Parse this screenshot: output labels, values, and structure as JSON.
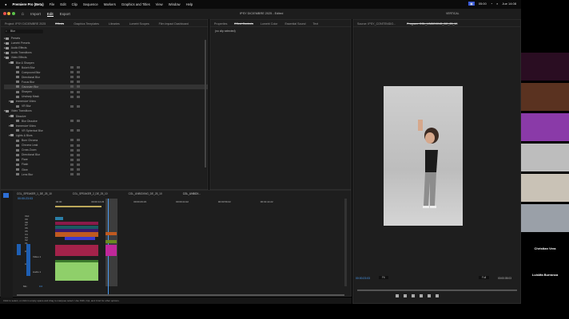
{
  "menubar": {
    "app": "Premiere Pro (Beta)",
    "items": [
      "File",
      "Edit",
      "Clip",
      "Sequence",
      "Markers",
      "Graphics and Titles",
      "View",
      "Window",
      "Help"
    ],
    "clock": "Jue 14:08",
    "battery": "05:00"
  },
  "appbar": {
    "tabs": [
      "Import",
      "Edit",
      "Export"
    ],
    "active": "Edit",
    "doc_title": "IPSY DICIEMBRE 2025 - Edited",
    "workspace": "VERTICAL"
  },
  "effects_panel": {
    "project_tab": "Project: IPSY DICIEMBRE 2025",
    "tabs": [
      "Effects",
      "Graphics Templates",
      "Libraries",
      "Lumetri Scopes",
      "Film Impact Dashboard"
    ],
    "search_value": "Blur",
    "items": [
      {
        "label": "Presets",
        "level": 0
      },
      {
        "label": "Lumetri Presets",
        "level": 0
      },
      {
        "label": "Audio Effects",
        "level": 0
      },
      {
        "label": "Audio Transitions",
        "level": 0
      },
      {
        "label": "Video Effects",
        "level": 0,
        "open": true
      },
      {
        "label": "Blur & Sharpen",
        "level": 1,
        "open": true
      },
      {
        "label": "Bokeh Blur",
        "level": 2
      },
      {
        "label": "Compound Blur",
        "level": 2
      },
      {
        "label": "Directional Blur",
        "level": 2
      },
      {
        "label": "Focus Blur",
        "level": 2
      },
      {
        "label": "Gaussian Blur",
        "level": 2,
        "selected": true
      },
      {
        "label": "Sharpen",
        "level": 2
      },
      {
        "label": "Unsharp Mask",
        "level": 2
      },
      {
        "label": "Immersive Video",
        "level": 1,
        "open": true
      },
      {
        "label": "VR Blur",
        "level": 2
      },
      {
        "label": "Video Transitions",
        "level": 0,
        "open": true
      },
      {
        "label": "Dissolve",
        "level": 1,
        "open": true
      },
      {
        "label": "Blur Dissolve",
        "level": 2
      },
      {
        "label": "Immersive Video",
        "level": 1,
        "open": true
      },
      {
        "label": "VR Spherical Blur",
        "level": 2
      },
      {
        "label": "Lights & Blurs",
        "level": 1,
        "open": true
      },
      {
        "label": "Burn Chroma",
        "level": 2
      },
      {
        "label": "Chroma Leak",
        "level": 2
      },
      {
        "label": "Cross Zoom",
        "level": 2
      },
      {
        "label": "Directional Blur",
        "level": 2
      },
      {
        "label": "Flare",
        "level": 2
      },
      {
        "label": "Flash",
        "level": 2
      },
      {
        "label": "Glow",
        "level": 2
      },
      {
        "label": "Lens Blur",
        "level": 2
      }
    ]
  },
  "effect_controls": {
    "tabs": [
      "Properties",
      "Effect Controls",
      "Lumetri Color",
      "Essential Sound",
      "Text"
    ],
    "message": "(no clip selected)"
  },
  "monitor": {
    "source_tab": "Source: IPSY_CONTENIDO...",
    "program_tab": "Program: CGL_UNBOXING_DE_25_10",
    "timecode": "00:00:23:03",
    "zoom": "Fit",
    "quality": "Full",
    "duration": "00:00:05:03"
  },
  "timeline": {
    "tabs": [
      "CGL_SPEAKER_1_DE_25_10",
      "CGL_SPEAKER_2_DE_25_10",
      "CGL_UNBOXING_DE_25_10",
      "CGL_UNBOX..."
    ],
    "timecode": "00:00:23:03",
    "ruler": [
      ":00:00",
      "00:00:14:23",
      "00:00:29:23",
      "00:00:44:22",
      "00:00:59:22",
      "00:01:14:22"
    ],
    "video_tracks": [
      "V10",
      "V9",
      "V8",
      "V7",
      "V6",
      "V5",
      "V4",
      "V3",
      "V2",
      "V1"
    ],
    "audio_tracks": [
      "A1",
      "A2"
    ],
    "v1_name": "Video 1",
    "a1_name": "Audio 1",
    "mix": "Mix",
    "mix_value": "0.0"
  },
  "status_bar": "Click to select, or click in empty space and drag to marquee select. Use Shift, Opt, and Cmd for other options.",
  "participants": [
    {
      "name": ""
    },
    {
      "name": ""
    },
    {
      "name": ""
    },
    {
      "name": ""
    },
    {
      "name": ""
    },
    {
      "name": ""
    },
    {
      "name": "Christian Vera"
    },
    {
      "name": "LuisMa Burranca"
    }
  ],
  "colors": {
    "accent": "#2d8ceb",
    "selected_track": "#1e5fb3",
    "video_clip": "#a3224a",
    "audio_clip": "#8fcf6a",
    "magenta": "#c0289a"
  }
}
